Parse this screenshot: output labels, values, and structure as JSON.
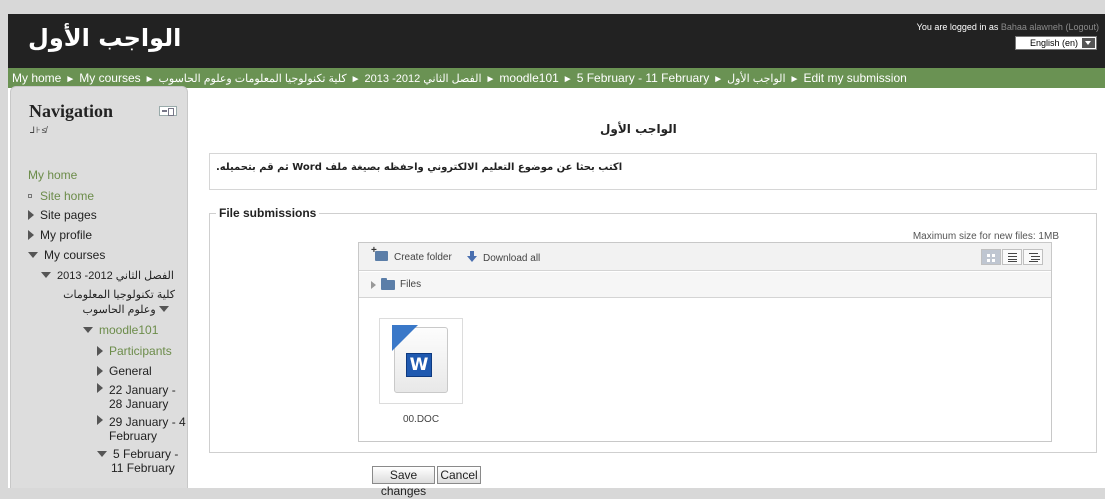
{
  "header": {
    "site_title": "الواجب الأول",
    "login_prefix": "You are logged in as ",
    "user_name": "Bahaa alawneh",
    "logout_label": "(Logout)",
    "language": "English (en)"
  },
  "breadcrumb": [
    "My home",
    "My courses",
    "كلية تكنولوجيا المعلومات وعلوم الحاسوب",
    "الفصل الثاني 2012- 2013",
    "moodle101",
    "5 February - 11 February",
    "الواجب الأول",
    "Edit my submission"
  ],
  "navigation": {
    "title": "Navigation",
    "subtitle": "⅃⊦≰",
    "items": [
      {
        "label": "My home"
      },
      {
        "label": "Site home"
      },
      {
        "label": "Site pages"
      },
      {
        "label": "My profile"
      },
      {
        "label": "My courses"
      },
      {
        "label": "الفصل الثاني 2012- 2013"
      },
      {
        "label": "كلية تكنولوجيا المعلومات وعلوم الحاسوب"
      },
      {
        "label": "moodle101"
      },
      {
        "label": "Participants"
      },
      {
        "label": "General"
      },
      {
        "label": "22 January - 28 January"
      },
      {
        "label": "29 January - 4 February"
      },
      {
        "label": "5 February - 11 February"
      }
    ]
  },
  "main": {
    "title": "الواجب الأول",
    "intro": "اكتب بحثا عن موضوع التعليم الالكتروني واحفظه بصيغة ملف Word ثم قم بتحميله.",
    "section_label": "File submissions",
    "max_size": "Maximum size for new files: 1MB",
    "create_folder": "Create folder",
    "download_all": "Download all",
    "path": "Files",
    "file": {
      "name": "00.DOC",
      "icon_letter": "W"
    },
    "save_label": "Save changes",
    "cancel_label": "Cancel"
  }
}
